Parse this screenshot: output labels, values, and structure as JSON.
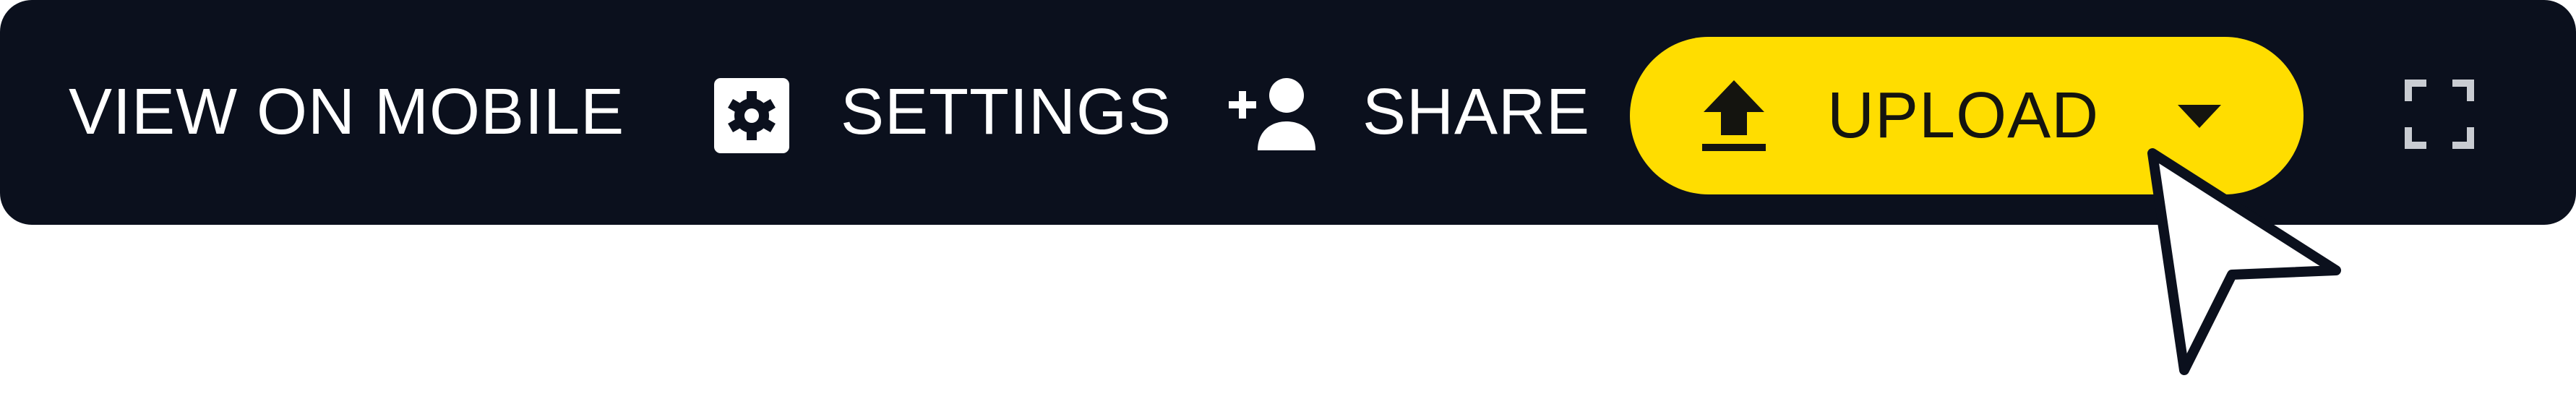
{
  "toolbar": {
    "view_mobile_label": "VIEW ON MOBILE",
    "settings_label": "SETTINGS",
    "share_label": "SHARE",
    "upload_label": "UPLOAD"
  },
  "icons": {
    "settings": "gear-icon",
    "share": "add-person-icon",
    "upload": "upload-arrow-icon",
    "dropdown": "caret-down-icon",
    "fullscreen": "fullscreen-icon",
    "cursor": "mouse-pointer-icon"
  },
  "colors": {
    "toolbar_background": "#0b101d",
    "text": "#ffffff",
    "upload_accent": "#ffdd00"
  }
}
